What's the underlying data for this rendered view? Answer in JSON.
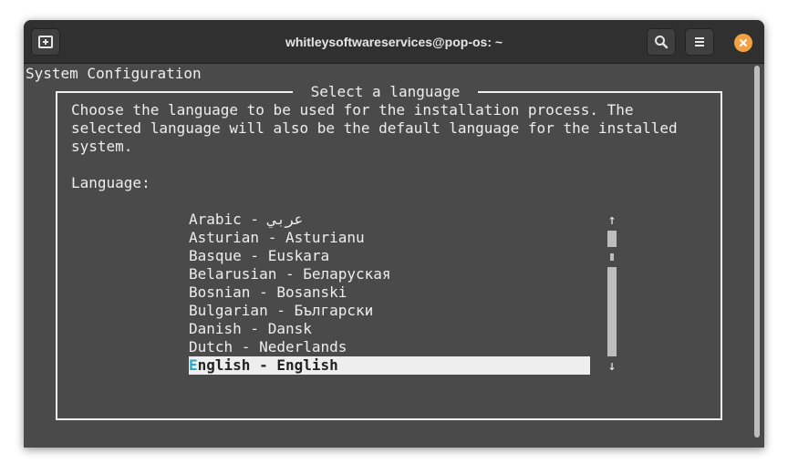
{
  "window": {
    "title": "whitleysoftwareservices@pop-os: ~"
  },
  "terminal": {
    "header": "System Configuration",
    "dialog": {
      "title": "Select a language",
      "description_lines": [
        "Choose the language to be used for the installation process. The",
        "selected language will also be the default language for the installed",
        "system."
      ],
      "prompt": "Language:",
      "languages": [
        "Arabic - عربي",
        "Asturian - Asturianu",
        "Basque - Euskara",
        "Belarusian - Беларуская",
        "Bosnian - Bosanski",
        "Bulgarian - Български",
        "Danish - Dansk",
        "Dutch - Nederlands"
      ],
      "selected": {
        "hotkey": "E",
        "rest": "nglish - English"
      },
      "scroll_up": "↑",
      "scroll_down": "↓"
    }
  },
  "colors": {
    "terminal_bg": "#4a4a4a",
    "titlebar_bg": "#303030",
    "close_button": "#f5a142",
    "hotkey": "#2aa8c8"
  }
}
